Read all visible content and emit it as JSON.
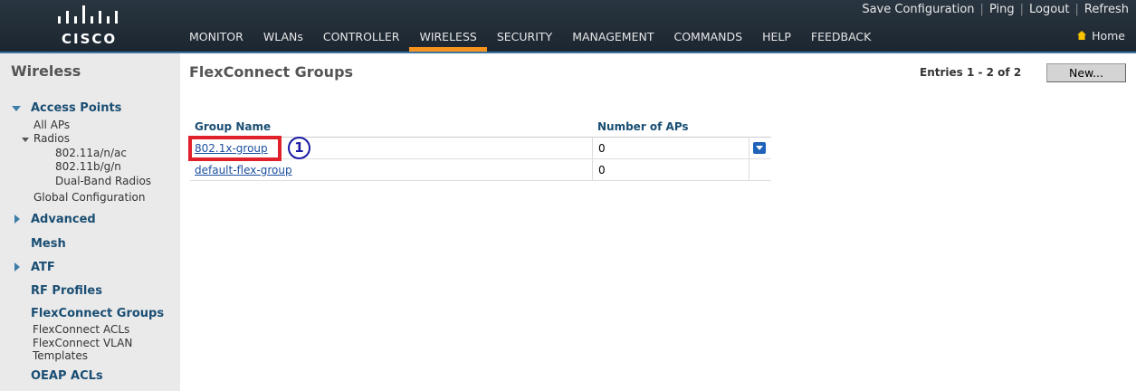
{
  "brand": {
    "logo_text": "CISCO"
  },
  "header": {
    "utility_links": [
      "Save Configuration",
      "Ping",
      "Logout",
      "Refresh"
    ],
    "menu": [
      "MONITOR",
      "WLANs",
      "CONTROLLER",
      "WIRELESS",
      "SECURITY",
      "MANAGEMENT",
      "COMMANDS",
      "HELP",
      "FEEDBACK"
    ],
    "active_menu": "WIRELESS",
    "home_label": "Home"
  },
  "sidebar": {
    "title": "Wireless",
    "access_points": "Access Points",
    "all_aps": "All APs",
    "radios": "Radios",
    "radio_a": "802.11a/n/ac",
    "radio_b": "802.11b/g/n",
    "radio_dual": "Dual-Band Radios",
    "global_config": "Global Configuration",
    "advanced": "Advanced",
    "mesh": "Mesh",
    "atf": "ATF",
    "rf_profiles": "RF Profiles",
    "flex_groups": "FlexConnect Groups",
    "flex_acls": "FlexConnect ACLs",
    "flex_vlan_1": "FlexConnect VLAN",
    "flex_vlan_2": "Templates",
    "oeap_acls": "OEAP ACLs"
  },
  "main": {
    "title": "FlexConnect Groups",
    "entries": "Entries 1 - 2 of 2",
    "new_button": "New...",
    "columns": {
      "group_name": "Group Name",
      "num_aps": "Number of APs"
    },
    "rows": [
      {
        "name": "802.1x-group",
        "aps": "0"
      },
      {
        "name": "default-flex-group",
        "aps": "0"
      }
    ],
    "callout": "1"
  },
  "colors": {
    "accent": "#f7941d",
    "link": "#1a4e9e",
    "highlight": "#e0212b",
    "callout": "#1a1aa6",
    "nav_bg": "#1f2a33"
  }
}
